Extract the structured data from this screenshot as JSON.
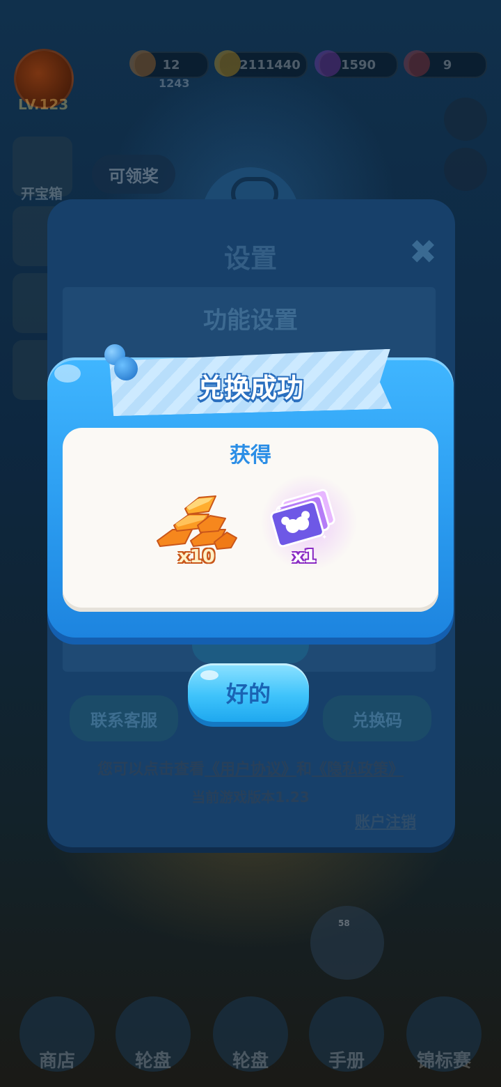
{
  "hud": {
    "level": "LV.123",
    "sublevel": "1243",
    "pills": [
      {
        "icon": "energy-icon",
        "value": "12"
      },
      {
        "icon": "coin-icon",
        "value": "2111440"
      },
      {
        "icon": "gem-icon",
        "value": "1590"
      },
      {
        "icon": "ticket-icon",
        "value": "9"
      }
    ],
    "reward_bubble": "可领奖",
    "left_caption": "开宝箱"
  },
  "settings": {
    "title": "设置",
    "section": "功能设置",
    "contact_button": "联系客服",
    "redeem_button": "兑换码",
    "policy": {
      "prefix": "您可以点击查看",
      "user_agreement": "《用户协议》",
      "and": "和",
      "privacy_policy": "《隐私政策》"
    },
    "version": "当前游戏版本1.23",
    "account_cancel": "账户注销"
  },
  "dialog": {
    "title": "兑换成功",
    "obtain_label": "获得",
    "rewards": [
      {
        "icon": "gold-bars-icon",
        "count": "x10"
      },
      {
        "icon": "card-pack-icon",
        "count": "x1"
      }
    ],
    "ok_button": "好的"
  },
  "bottom_nav": [
    "商店",
    "轮盘",
    "轮盘",
    "手册",
    "锦标赛"
  ],
  "colors": {
    "dialog_blue": "#2b9cf0",
    "button_cyan": "#3fc3fb",
    "title_stroke": "#2a6fbf",
    "gold": "#f38a1c",
    "purple": "#8a2bc4"
  }
}
